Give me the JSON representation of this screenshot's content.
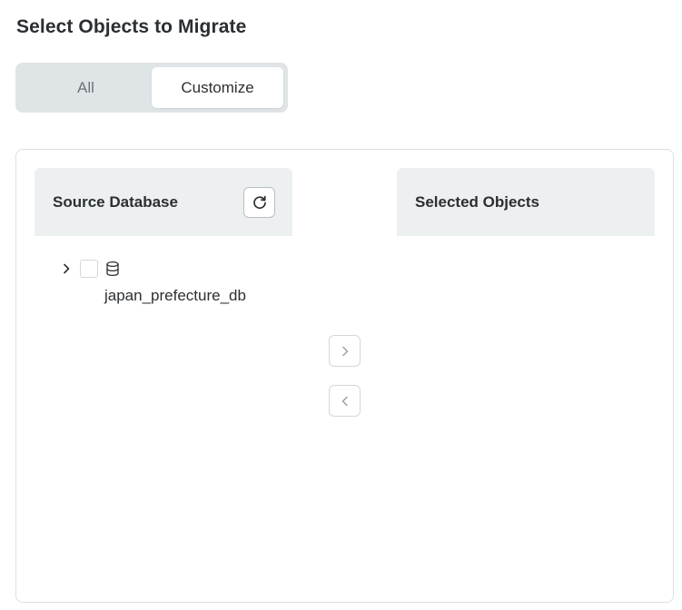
{
  "page": {
    "title": "Select Objects to Migrate"
  },
  "mode_toggle": {
    "options": [
      {
        "label": "All",
        "selected": false
      },
      {
        "label": "Customize",
        "selected": true
      }
    ]
  },
  "source_panel": {
    "title": "Source Database",
    "refresh_icon": "refresh-icon",
    "tree": [
      {
        "label": "japan_prefecture_db",
        "icon": "database-icon",
        "expanded": false,
        "checked": false
      }
    ]
  },
  "target_panel": {
    "title": "Selected Objects",
    "items": []
  },
  "transfer_buttons": {
    "add_icon": "chevron-right-icon",
    "remove_icon": "chevron-left-icon"
  },
  "colors": {
    "toggle_bg": "#dfe4e6",
    "panel_header_bg": "#edf0f1",
    "text": "#2b2f33",
    "muted_text": "#6d7377"
  }
}
